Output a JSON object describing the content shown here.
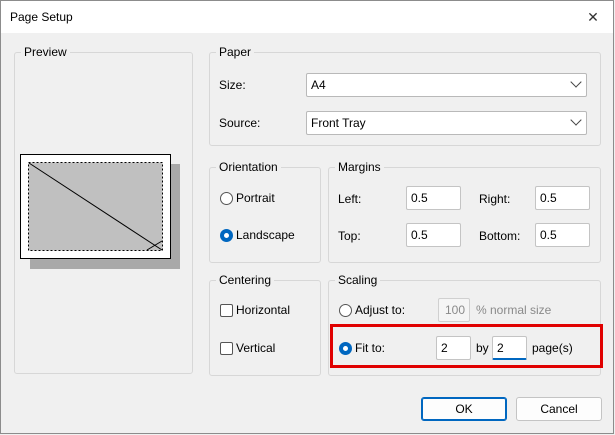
{
  "window": {
    "title": "Page Setup"
  },
  "icons": {
    "close": "close-icon",
    "chevron": "chevron-down-icon"
  },
  "preview": {
    "label": "Preview"
  },
  "paper": {
    "label": "Paper",
    "size_label": "Size:",
    "size_value": "A4",
    "source_label": "Source:",
    "source_value": "Front Tray"
  },
  "orientation": {
    "label": "Orientation",
    "portrait": "Portrait",
    "landscape": "Landscape",
    "selected": "landscape"
  },
  "margins": {
    "label": "Margins",
    "left_label": "Left:",
    "left_value": "0.5",
    "right_label": "Right:",
    "right_value": "0.5",
    "top_label": "Top:",
    "top_value": "0.5",
    "bottom_label": "Bottom:",
    "bottom_value": "0.5"
  },
  "centering": {
    "label": "Centering",
    "horizontal": "Horizontal",
    "vertical": "Vertical"
  },
  "scaling": {
    "label": "Scaling",
    "adjust_label": "Adjust to:",
    "adjust_value": "100",
    "adjust_unit": "% normal size",
    "fit_label": "Fit to:",
    "fit_wide": "2",
    "by_label": "by",
    "fit_tall": "2",
    "pages_label": "page(s)",
    "selected": "fit"
  },
  "buttons": {
    "ok": "OK",
    "cancel": "Cancel"
  },
  "colors": {
    "accent": "#0067c0",
    "highlight": "#e00000"
  }
}
